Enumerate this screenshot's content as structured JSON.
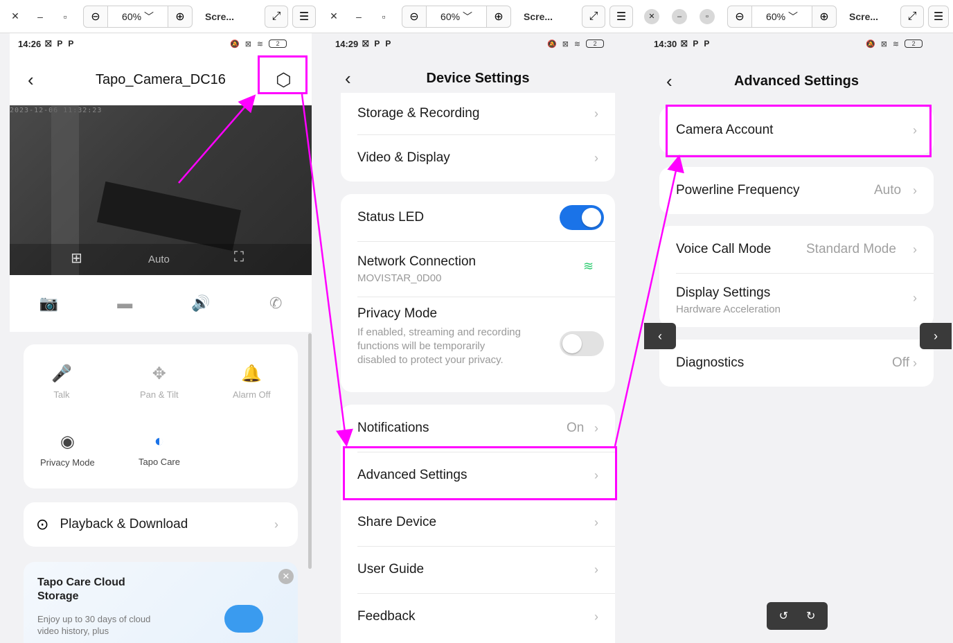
{
  "toolbar": {
    "zoom": "60%",
    "title": "Scre..."
  },
  "screen1": {
    "time": "14:26",
    "title": "Tapo_Camera_DC16",
    "timestamp": "2023-12-06 11:32:23",
    "video_mode": "Auto",
    "quick_actions": [
      {
        "label": "Talk",
        "icon": "microphone-icon"
      },
      {
        "label": "Pan & Tilt",
        "icon": "pan-tilt-icon"
      },
      {
        "label": "Alarm Off",
        "icon": "alarm-icon"
      },
      {
        "label": "Privacy Mode",
        "icon": "privacy-icon"
      },
      {
        "label": "Tapo Care",
        "icon": "tapo-care-icon"
      }
    ],
    "playback_label": "Playback & Download",
    "promo_title": "Tapo Care Cloud Storage",
    "promo_text": "Enjoy up to 30 days of cloud video history, plus"
  },
  "screen2": {
    "time": "14:29",
    "title": "Device Settings",
    "items": {
      "storage": "Storage & Recording",
      "video": "Video & Display",
      "status_led": "Status LED",
      "network": "Network Connection",
      "network_sub": "MOVISTAR_0D00",
      "privacy": "Privacy Mode",
      "privacy_sub": "If enabled, streaming and recording functions will be temporarily disabled to protect your privacy.",
      "notifications": "Notifications",
      "notifications_val": "On",
      "advanced": "Advanced Settings",
      "share": "Share Device",
      "guide": "User Guide",
      "feedback": "Feedback"
    },
    "status_led_on": true,
    "privacy_mode_on": false
  },
  "screen3": {
    "time": "14:30",
    "title": "Advanced Settings",
    "items": {
      "camera_account": "Camera Account",
      "powerline": "Powerline Frequency",
      "powerline_val": "Auto",
      "voice": "Voice Call Mode",
      "voice_val": "Standard Mode",
      "display": "Display Settings",
      "display_sub": "Hardware Acceleration",
      "diagnostics": "Diagnostics",
      "diagnostics_val": "Off"
    }
  },
  "colors": {
    "highlight": "#ff00ff",
    "toggle_on": "#1a73e8",
    "toggle_off": "#e2e2e2",
    "wifi": "#2ecc71"
  }
}
